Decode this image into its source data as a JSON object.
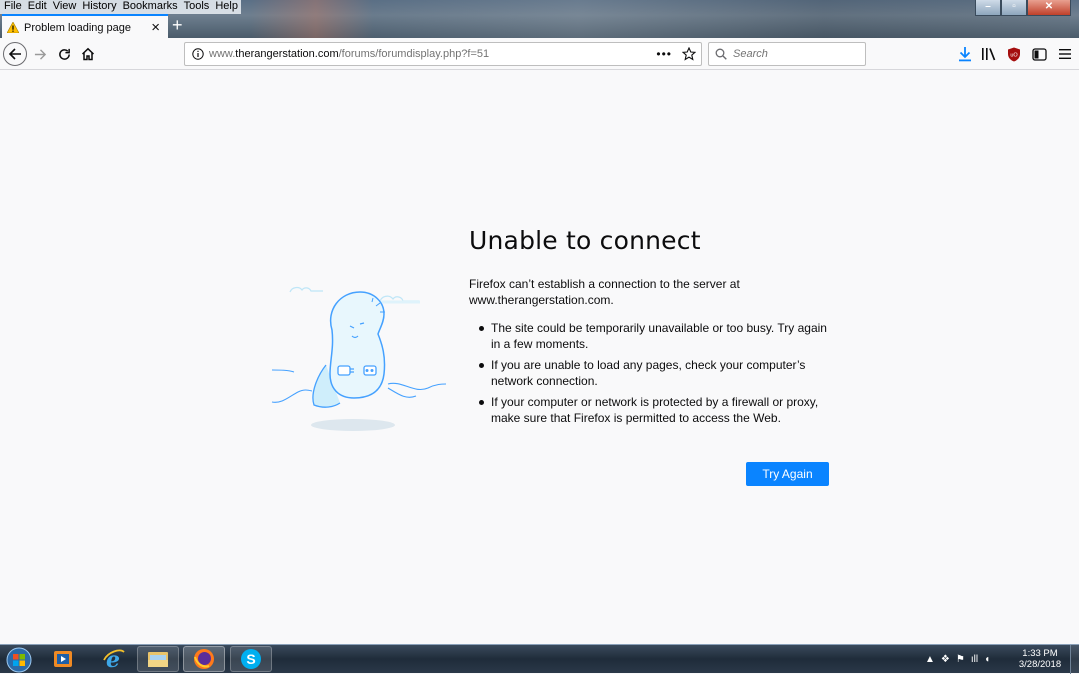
{
  "menubar": {
    "items": [
      "File",
      "Edit",
      "View",
      "History",
      "Bookmarks",
      "Tools",
      "Help"
    ]
  },
  "tab": {
    "title": "Problem loading page",
    "close": "×"
  },
  "new_tab": "+",
  "urlbar": {
    "host_prefix": "www.",
    "host": "therangerstation.com",
    "path": "/forums/forumdisplay.php?f=51",
    "more": "•••"
  },
  "search": {
    "placeholder": "Search"
  },
  "error": {
    "title": "Unable to connect",
    "intro": "Firefox can’t establish a connection to the server at www.therangerstation.com.",
    "bullets": [
      "The site could be temporarily unavailable or too busy. Try again in a few moments.",
      "If you are unable to load any pages, check your computer’s network connection.",
      "If your computer or network is protected by a firewall or proxy, make sure that Firefox is permitted to access the Web."
    ],
    "button": "Try Again"
  },
  "clock": {
    "time": "1:33 PM",
    "date": "3/28/2018"
  },
  "colors": {
    "accent": "#0a84ff",
    "page_bg": "#f9f9fa",
    "text": "#0c0c0d"
  }
}
